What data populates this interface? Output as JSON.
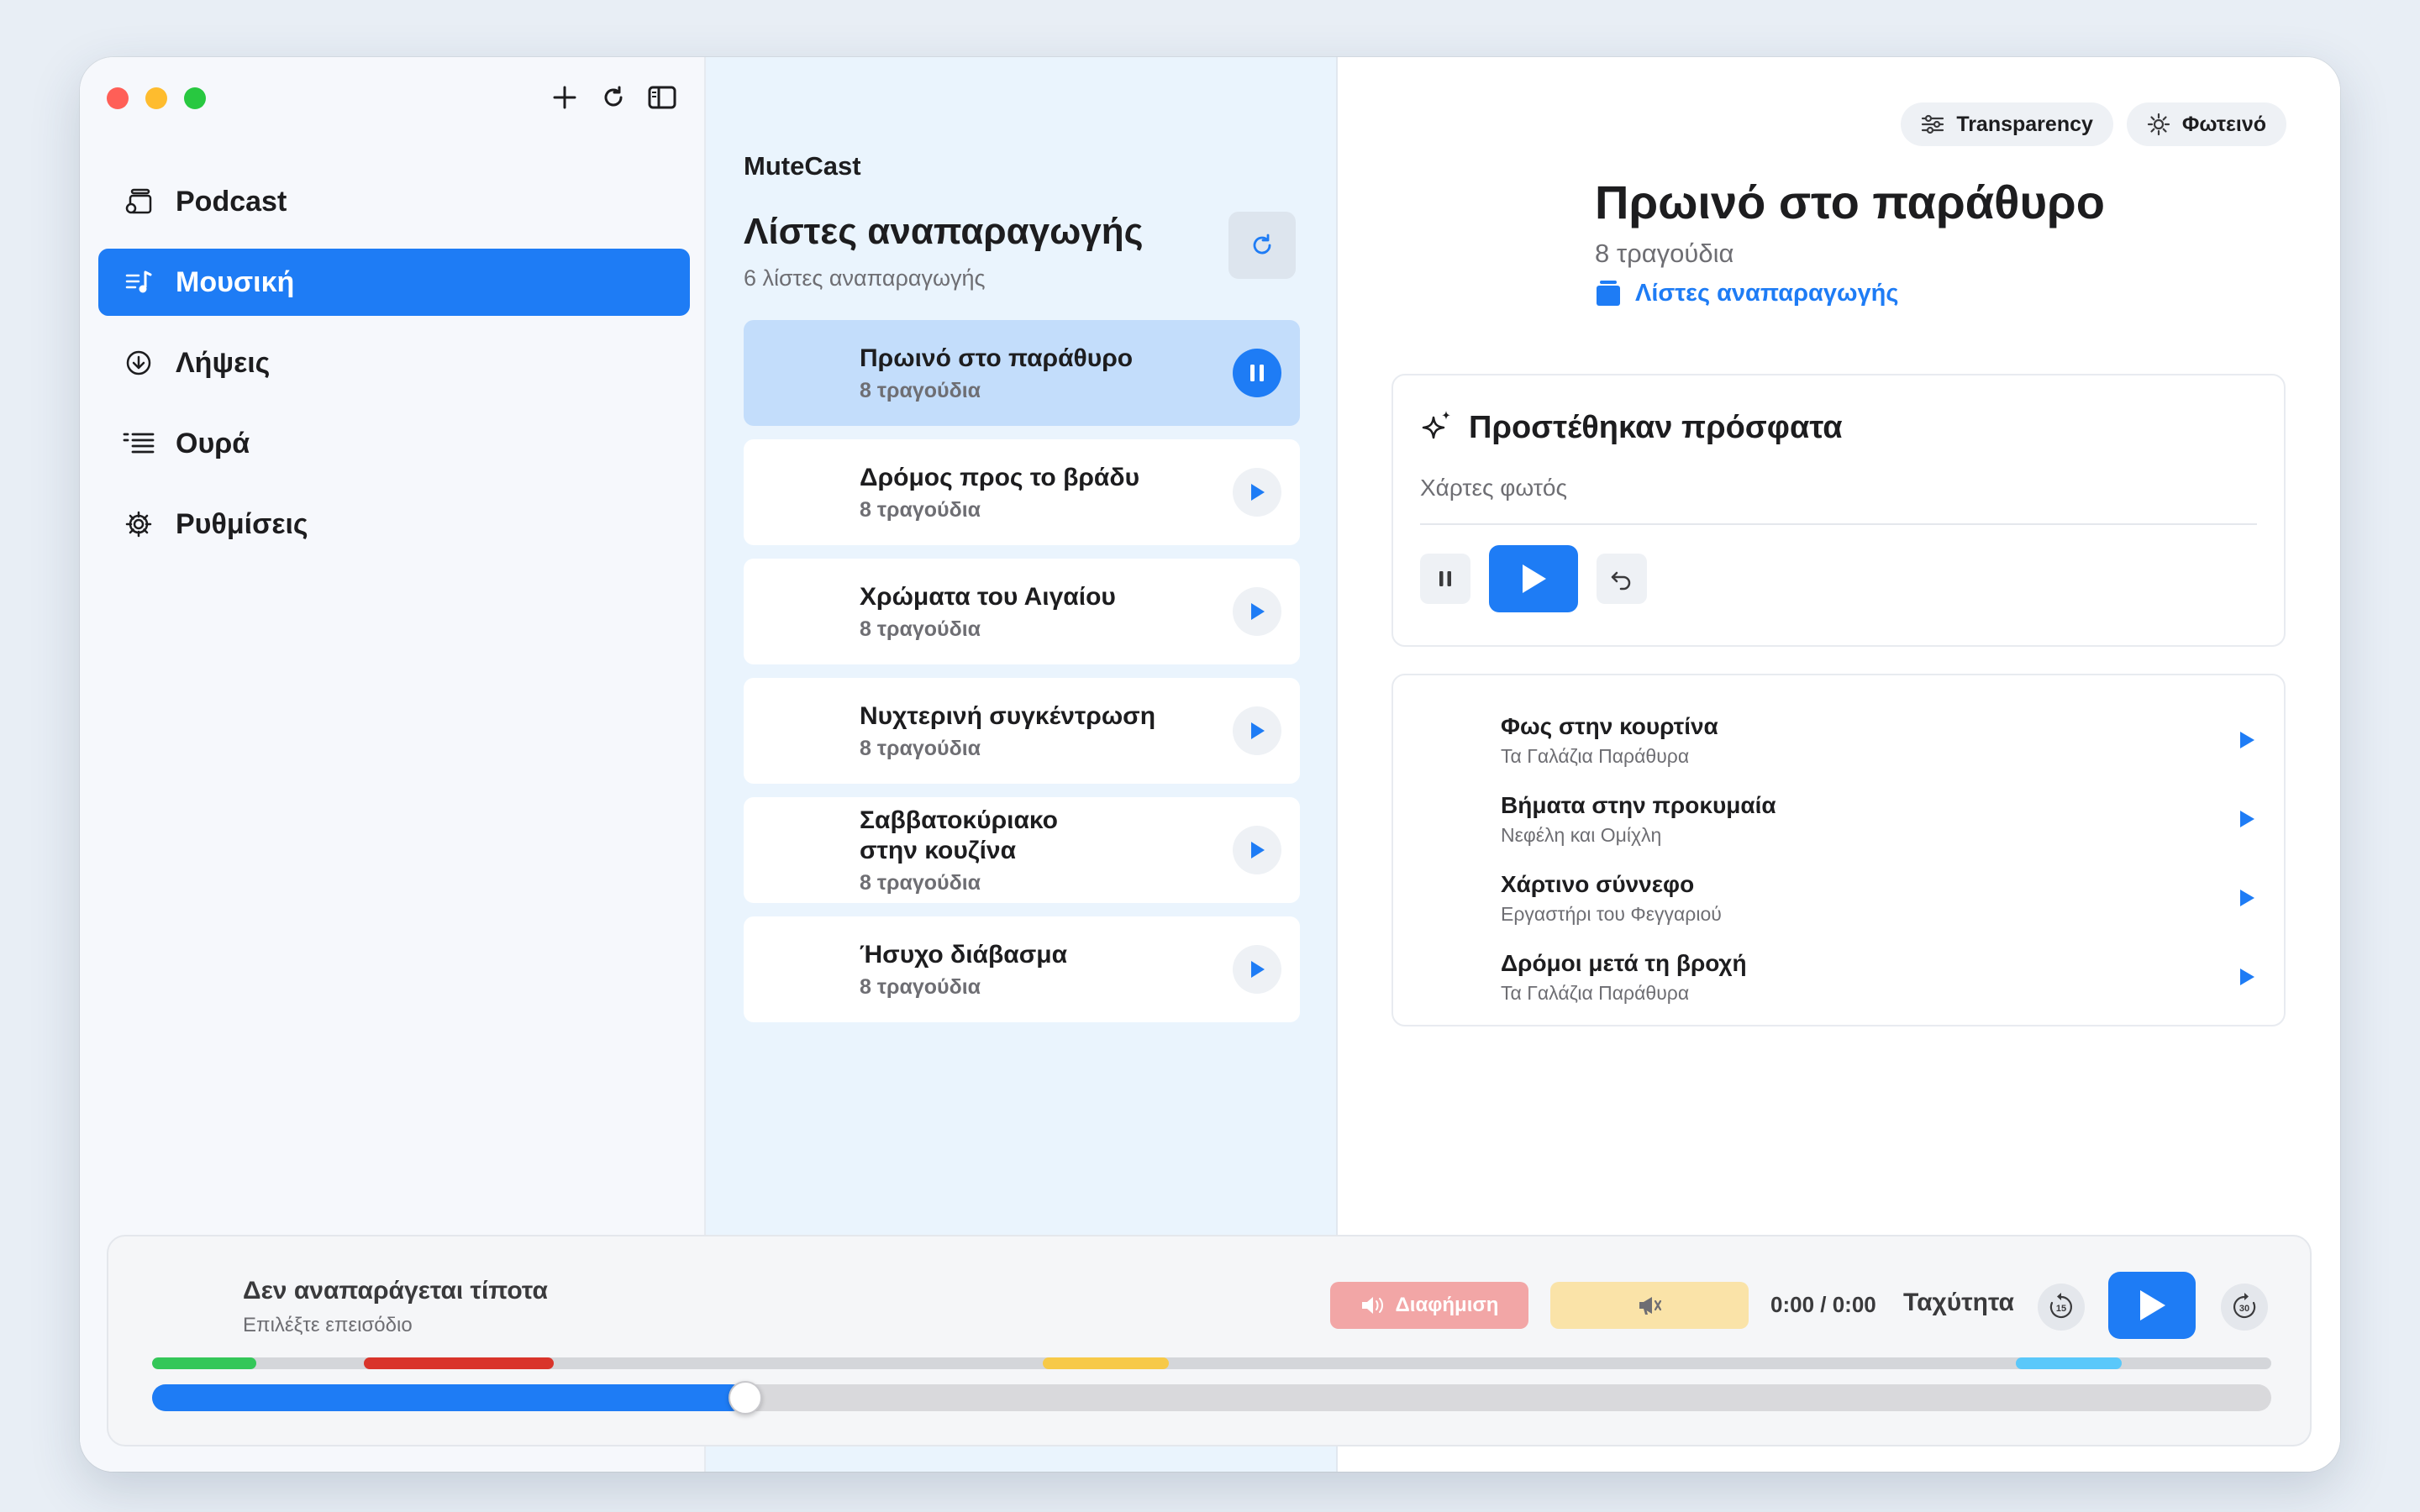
{
  "colors": {
    "accent": "#1e7cf5",
    "red": "#ff5f57",
    "yellow": "#febc2e",
    "green": "#28c840"
  },
  "sidebar": {
    "items": [
      {
        "label": "Podcast",
        "icon": "podcast-stack-icon",
        "active": false
      },
      {
        "label": "Μουσική",
        "icon": "music-list-icon",
        "active": true
      },
      {
        "label": "Λήψεις",
        "icon": "download-circle-icon",
        "active": false
      },
      {
        "label": "Ουρά",
        "icon": "queue-list-icon",
        "active": false
      },
      {
        "label": "Ρυθμίσεις",
        "icon": "gear-icon",
        "active": false
      }
    ]
  },
  "middle": {
    "app_name": "MuteCast",
    "title": "Λίστες αναπαραγωγής",
    "subtitle": "6 λίστες αναπαραγωγής",
    "playlists": [
      {
        "name": "Πρωινό στο παράθυρο",
        "count": "8 τραγούδια",
        "active": true
      },
      {
        "name": "Δρόμος προς το βράδυ",
        "count": "8 τραγούδια",
        "active": false
      },
      {
        "name": "Χρώματα του Αιγαίου",
        "count": "8 τραγούδια",
        "active": false
      },
      {
        "name": "Νυχτερινή συγκέντρωση",
        "count": "8 τραγούδια",
        "active": false
      },
      {
        "name": "Σαββατοκύριακο στην κουζίνα",
        "count": "8 τραγούδια",
        "active": false
      },
      {
        "name": "Ήσυχο διάβασμα",
        "count": "8 τραγούδια",
        "active": false
      }
    ]
  },
  "detail": {
    "chip_transparency": "Transparency",
    "chip_theme": "Φωτεινό",
    "title": "Πρωινό στο παράθυρο",
    "count": "8 τραγούδια",
    "link": "Λίστες αναπαραγωγής",
    "recent_title": "Προστέθηκαν πρόσφατα",
    "recent_field": "Χάρτες φωτός",
    "tracks": [
      {
        "name": "Φως στην κουρτίνα",
        "artist": "Τα Γαλάζια Παράθυρα"
      },
      {
        "name": "Βήματα στην προκυμαία",
        "artist": "Νεφέλη και Ομίχλη"
      },
      {
        "name": "Χάρτινο σύννεφο",
        "artist": "Εργαστήρι του Φεγγαριού"
      },
      {
        "name": "Δρόμοι μετά τη βροχή",
        "artist": "Τα Γαλάζια Παράθυρα"
      }
    ]
  },
  "player": {
    "title": "Δεν αναπαράγεται τίποτα",
    "subtitle": "Επιλέξτε επεισόδιο",
    "ad_label": "Διαφήμιση",
    "time": "0:00 / 0:00",
    "speed": "Ταχύτητα",
    "skip_back": "15",
    "skip_forward": "30",
    "progress_fraction": 0.28,
    "chapter_colors": [
      "#34c759",
      "#d9342b",
      "#f7c948",
      "#5ac8fa"
    ]
  }
}
